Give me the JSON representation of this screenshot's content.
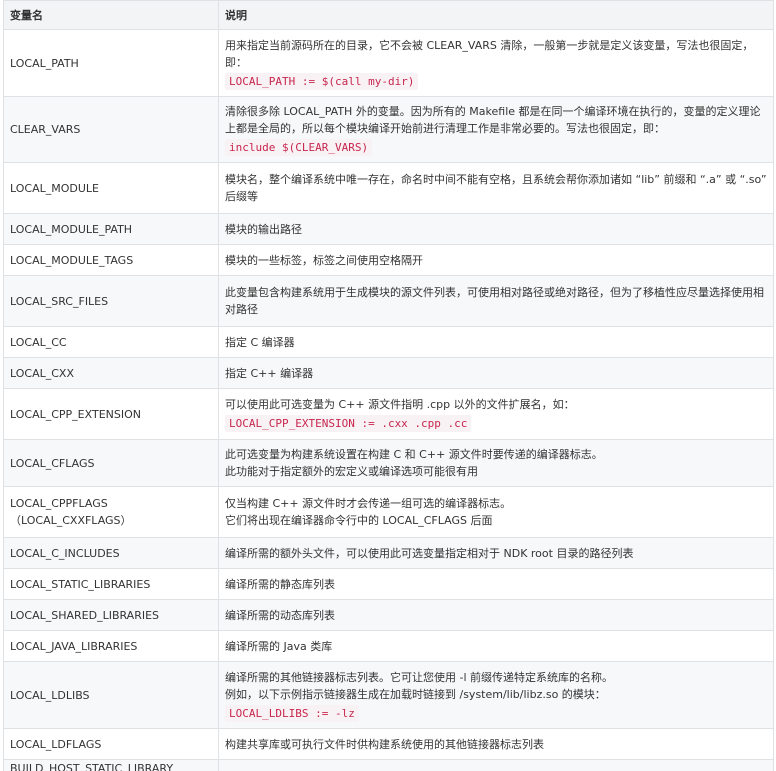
{
  "headers": {
    "name": "变量名",
    "desc": "说明"
  },
  "rows": [
    {
      "name": [
        "LOCAL_PATH"
      ],
      "desc": [
        "用来指定当前源码所在的目录，它不会被 CLEAR_VARS 清除，一般第一步就是定义该变量，写法也很固定，即："
      ],
      "code": "LOCAL_PATH := $(call my-dir)"
    },
    {
      "name": [
        "CLEAR_VARS"
      ],
      "desc": [
        "清除很多除 LOCAL_PATH 外的变量。因为所有的 Makefile 都是在同一个编译环境在执行的，变量的定义理论上都是全局的，所以每个模块编译开始前进行清理工作是非常必要的。写法也很固定，即："
      ],
      "code": "include $(CLEAR_VARS)"
    },
    {
      "name": [
        "LOCAL_MODULE"
      ],
      "desc": [
        "模块名，整个编译系统中唯一存在，命名时中间不能有空格，且系统会帮你添加诸如 “lib” 前缀和 “.a” 或 “.so” 后缀等"
      ]
    },
    {
      "name": [
        "LOCAL_MODULE_PATH"
      ],
      "desc": [
        "模块的输出路径"
      ]
    },
    {
      "name": [
        "LOCAL_MODULE_TAGS"
      ],
      "desc": [
        "模块的一些标签，标签之间使用空格隔开"
      ]
    },
    {
      "name": [
        "LOCAL_SRC_FILES"
      ],
      "desc": [
        "此变量包含构建系统用于生成模块的源文件列表，可使用相对路径或绝对路径，但为了移植性应尽量选择使用相对路径"
      ]
    },
    {
      "name": [
        "LOCAL_CC"
      ],
      "desc": [
        "指定 C 编译器"
      ]
    },
    {
      "name": [
        "LOCAL_CXX"
      ],
      "desc": [
        "指定 C++ 编译器"
      ]
    },
    {
      "name": [
        "LOCAL_CPP_EXTENSION"
      ],
      "desc": [
        "可以使用此可选变量为 C++ 源文件指明 .cpp 以外的文件扩展名，如："
      ],
      "code": "LOCAL_CPP_EXTENSION := .cxx .cpp .cc"
    },
    {
      "name": [
        "LOCAL_CFLAGS"
      ],
      "desc": [
        "此可选变量为构建系统设置在构建 C 和 C++ 源文件时要传递的编译器标志。",
        "此功能对于指定额外的宏定义或编译选项可能很有用"
      ]
    },
    {
      "name": [
        "LOCAL_CPPFLAGS",
        "（LOCAL_CXXFLAGS）"
      ],
      "desc": [
        "仅当构建 C++ 源文件时才会传递一组可选的编译器标志。",
        "它们将出现在编译器命令行中的 LOCAL_CFLAGS 后面"
      ]
    },
    {
      "name": [
        "LOCAL_C_INCLUDES"
      ],
      "desc": [
        "编译所需的额外头文件，可以使用此可选变量指定相对于 NDK root 目录的路径列表"
      ]
    },
    {
      "name": [
        "LOCAL_STATIC_LIBRARIES"
      ],
      "desc": [
        "编译所需的静态库列表"
      ]
    },
    {
      "name": [
        "LOCAL_SHARED_LIBRARIES"
      ],
      "desc": [
        "编译所需的动态库列表"
      ]
    },
    {
      "name": [
        "LOCAL_JAVA_LIBRARIES"
      ],
      "desc": [
        "编译所需的 Java 类库"
      ]
    },
    {
      "name": [
        "LOCAL_LDLIBS"
      ],
      "desc": [
        "编译所需的其他链接器标志列表。它可让您使用 -l 前缀传递特定系统库的名称。",
        "例如，以下示例指示链接器生成在加载时链接到 /system/lib/libz.so 的模块："
      ],
      "code": "LOCAL_LDLIBS := -lz"
    },
    {
      "name": [
        "LOCAL_LDFLAGS"
      ],
      "desc": [
        "构建共享库或可执行文件时供构建系统使用的其他链接器标志列表"
      ]
    },
    {
      "name": [
        "BUILD_HOST_STATIC_LIBRARY"
      ],
      "desc": [
        ""
      ]
    }
  ]
}
